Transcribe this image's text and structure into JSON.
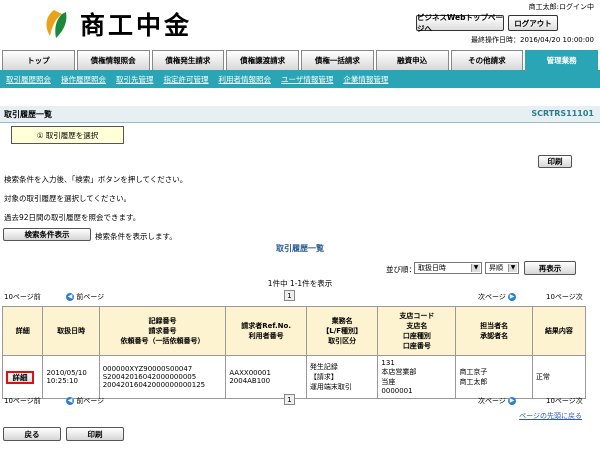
{
  "header": {
    "brand": "商工中金",
    "user": "商工太郎:ログイン中",
    "top_page_button": "ビジネスWebトップページへ",
    "logout_button": "ログアウト",
    "last_operation": "最終操作日時：2016/04/20 10:00:00"
  },
  "tabs": [
    "トップ",
    "債権情報照会",
    "債権発生請求",
    "債権譲渡請求",
    "債権一括請求",
    "融資申込",
    "その他請求",
    "管理業務"
  ],
  "subnav": [
    "取引履歴照会",
    "操作履歴照会",
    "取引先管理",
    "指定許可管理",
    "利用者情報照会",
    "ユーザ情報管理",
    "企業情報管理"
  ],
  "page": {
    "title": "取引履歴一覧",
    "code": "SCRTRS11101",
    "step_label": "① 取引履歴を選択",
    "print_button": "印刷",
    "instruction1": "検索条件を入力後、「検索」ボタンを押してください。",
    "instruction2": "対象の取引履歴を選択してください。",
    "instruction3": "過去92日間の取引履歴を照会できます。",
    "show_search_button": "検索条件表示",
    "show_search_hint": "検索条件を表示します。"
  },
  "list": {
    "title": "取引履歴一覧",
    "sort_label": "並び順：",
    "sort_value": "取扱日時",
    "order_value": "昇順",
    "resort_button": "再表示",
    "count_text": "1件中 1-1件を表示",
    "prev10": "10ページ前",
    "prev": "前ページ",
    "page_number": "1",
    "next": "次ページ",
    "next10": "10ページ次"
  },
  "table": {
    "headers": [
      "詳細",
      "取扱日時",
      "記録番号\n請求番号\n依頼番号（一括依頼番号）",
      "請求者Ref.No.\n利用者番号",
      "業務名\n【L/F種別】\n取引区分",
      "支店コード\n支店名\n口座種別\n口座番号",
      "担当者名\n承認者名",
      "結果内容"
    ],
    "rows": [
      {
        "detail": "詳細",
        "datetime": "2010/05/10\n10:25:10",
        "numbers": "000000XYZ90000S00047\nS20042016042000000005\n20042016042000000000125",
        "ref": "AAXX00001\n2004AB100",
        "business": "発生記録\n【請求】\n運用端末取引",
        "branch": "131\n本店営業部\n当座\n0000001",
        "staff": "商工京子\n商工太郎",
        "result": "正常"
      }
    ]
  },
  "footer": {
    "back_to_top": "ページの先頭に戻る",
    "back_button": "戻る",
    "print_button": "印刷"
  }
}
